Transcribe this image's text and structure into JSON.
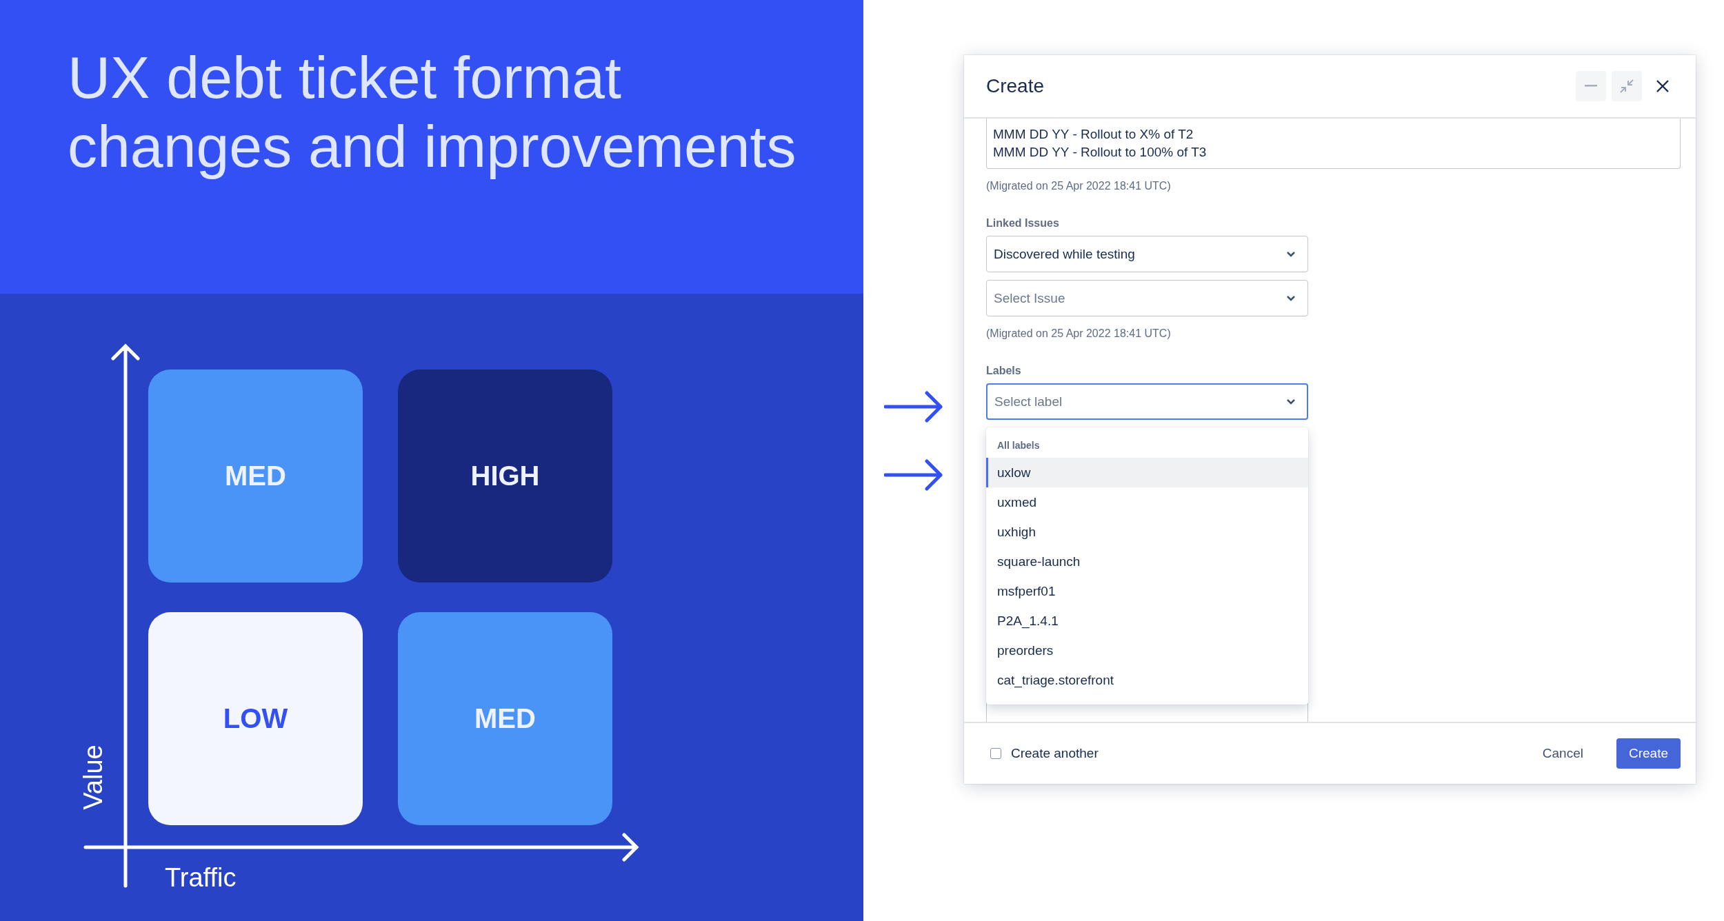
{
  "slide": {
    "title": "UX debt ticket format changes and improvements"
  },
  "matrix": {
    "y_axis": "Value",
    "x_axis": "Traffic",
    "cells": [
      {
        "label": "MED",
        "kind": "med"
      },
      {
        "label": "HIGH",
        "kind": "high"
      },
      {
        "label": "LOW",
        "kind": "low"
      },
      {
        "label": "MED",
        "kind": "med"
      }
    ]
  },
  "dialog": {
    "title": "Create",
    "description_lines": [
      "MMM DD YY - Rollout to X% of T2",
      "MMM DD YY - Rollout to 100% of T3"
    ],
    "description_note": "(Migrated on 25 Apr 2022 18:41 UTC)",
    "linked_issues": {
      "label": "Linked Issues",
      "link_type": {
        "value": "Discovered while testing"
      },
      "issue": {
        "placeholder": "Select Issue"
      },
      "note": "(Migrated on 25 Apr 2022 18:41 UTC)"
    },
    "labels": {
      "label": "Labels",
      "field": {
        "placeholder": "Select label",
        "focused": true
      },
      "menu": {
        "heading": "All labels",
        "options": [
          {
            "label": "uxlow",
            "selected": true
          },
          {
            "label": "uxmed",
            "selected": false
          },
          {
            "label": "uxhigh",
            "selected": false
          },
          {
            "label": "square-launch",
            "selected": false
          },
          {
            "label": "msfperf01",
            "selected": false
          },
          {
            "label": "P2A_1.4.1",
            "selected": false
          },
          {
            "label": "preorders",
            "selected": false
          },
          {
            "label": "cat_triage.storefront",
            "selected": false
          }
        ]
      }
    },
    "footer": {
      "create_another": {
        "label": "Create another",
        "checked": false
      },
      "buttons": [
        {
          "label": "Cancel",
          "kind": "subtle"
        },
        {
          "label": "Create",
          "kind": "primary"
        }
      ]
    }
  }
}
